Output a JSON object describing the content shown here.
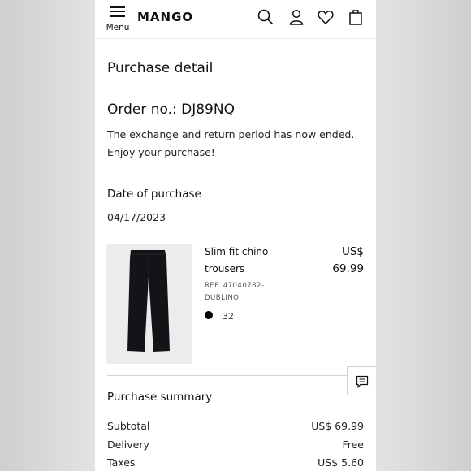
{
  "header": {
    "menu_label": "Menu",
    "logo": "MANGO",
    "icons": [
      "search-icon",
      "user-icon",
      "heart-icon",
      "bag-icon"
    ]
  },
  "page": {
    "title": "Purchase detail",
    "order_label": "Order no.: DJ89NQ",
    "note_line1": "The exchange and return period has now ended.",
    "note_line2": "Enjoy your purchase!",
    "date_label": "Date of purchase",
    "date_value": "04/17/2023"
  },
  "item": {
    "name_line1": "Slim fit chino",
    "name_line2": "trousers",
    "ref_line1": "REF. 47040782-",
    "ref_line2": "DUBLINO",
    "color": "#000000",
    "size": "32",
    "price_line1": "US$",
    "price_line2": "69.99"
  },
  "summary": {
    "title": "Purchase summary",
    "rows": [
      {
        "label": "Subtotal",
        "value": "US$ 69.99"
      },
      {
        "label": "Delivery",
        "value": "Free"
      },
      {
        "label": "Taxes",
        "value": "US$ 5.60"
      }
    ]
  }
}
